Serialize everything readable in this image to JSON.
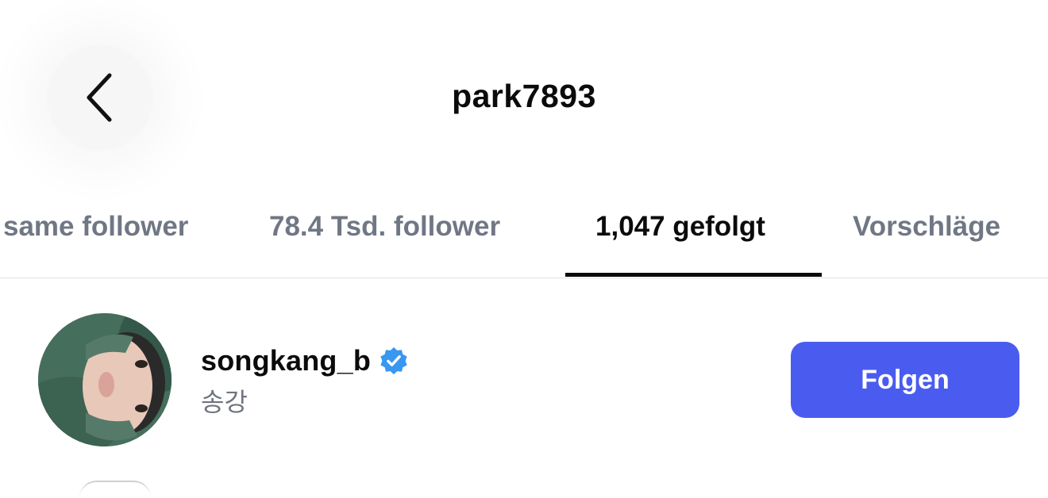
{
  "header": {
    "title": "park7893",
    "back_icon": "chevron-left-icon"
  },
  "tabs": [
    {
      "label": "same follower",
      "active": false
    },
    {
      "label": "78.4 Tsd. follower",
      "active": false
    },
    {
      "label": "1,047 gefolgt",
      "active": true
    },
    {
      "label": "Vorschläge",
      "active": false
    }
  ],
  "list": {
    "items": [
      {
        "username": "songkang_b",
        "full_name": "송강",
        "verified": true,
        "follow_label": "Folgen"
      }
    ]
  },
  "colors": {
    "accent": "#4a5cf0",
    "verified": "#3897f0",
    "muted_text": "#707784"
  }
}
